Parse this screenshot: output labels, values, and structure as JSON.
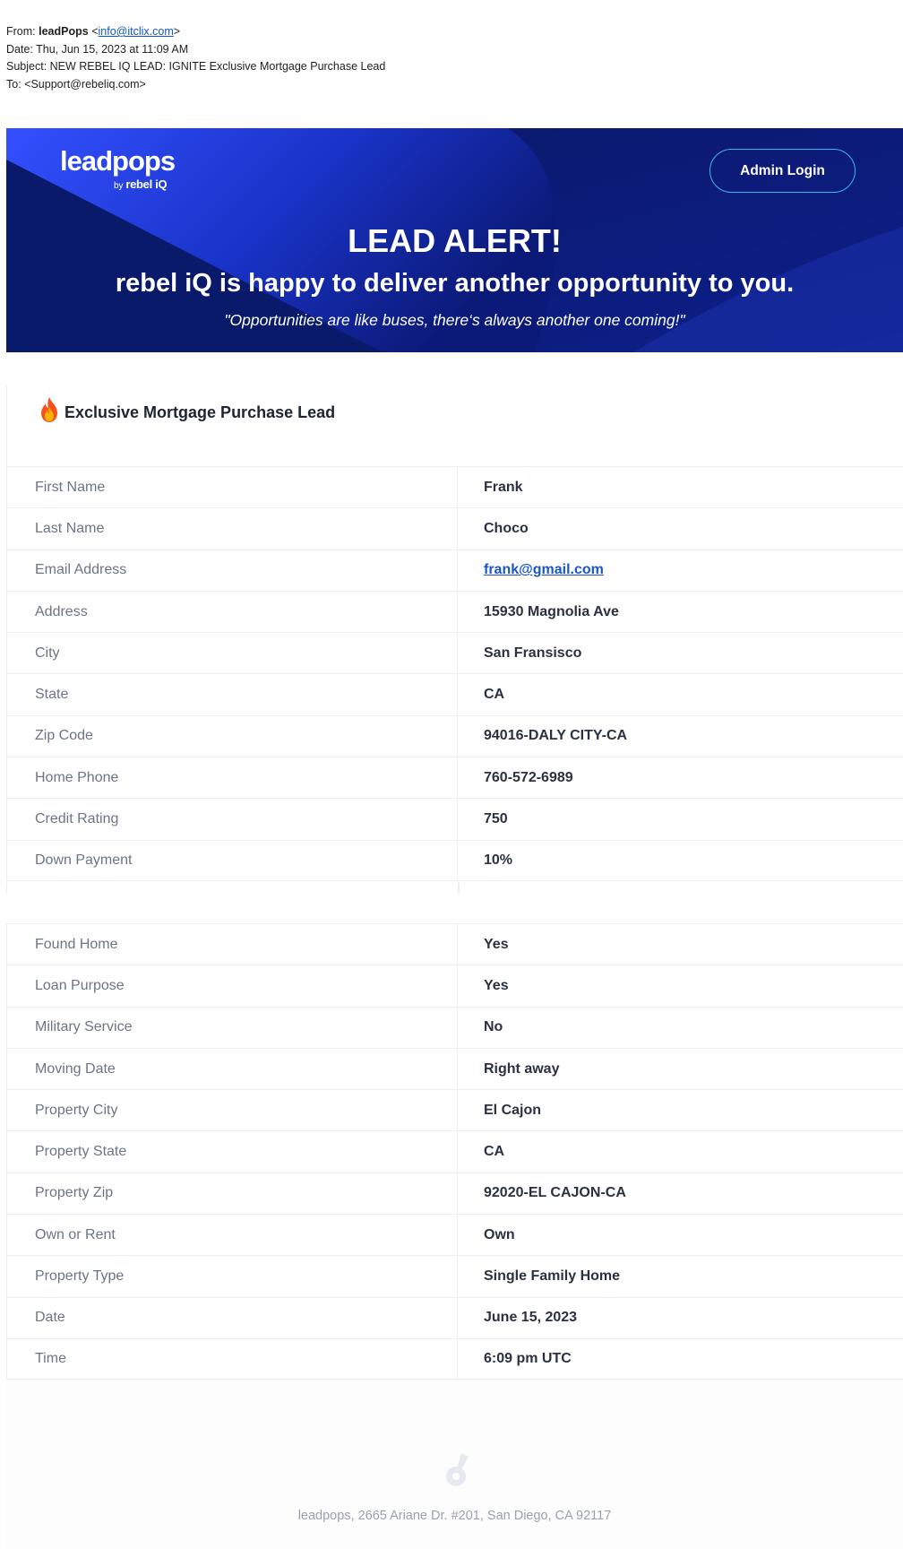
{
  "email": {
    "from_label": "From:",
    "from_name": "leadPops",
    "from_open": "<",
    "from_email": "info@itclix.com",
    "from_close": ">",
    "date_line": "Date: Thu, Jun 15, 2023 at 11:09 AM",
    "subject_line": "Subject: NEW REBEL IQ LEAD: IGNITE Exclusive Mortgage Purchase Lead",
    "to_line": "To: <Support@rebeliq.com>"
  },
  "banner": {
    "logo_word": "leadpops",
    "logo_by": "by",
    "logo_brand": "rebel iQ",
    "admin_login": "Admin Login",
    "title": "LEAD ALERT!",
    "subtitle": "rebel iQ is happy to deliver another opportunity to you.",
    "quote": "\"Opportunities are like buses, there‘s always another one coming!\"",
    "colors": {
      "dark": "#0a1a6b",
      "bright": "#2f4ff0",
      "button_border": "#3fb4e8"
    }
  },
  "lead": {
    "title": "Exclusive Mortgage Purchase Lead",
    "icon": "fire-icon"
  },
  "table1": [
    {
      "label": "First Name",
      "value": "Frank"
    },
    {
      "label": "Last Name",
      "value": "Choco"
    },
    {
      "label": "Email Address",
      "value": "frank@gmail.com"
    },
    {
      "label": "Address",
      "value": "15930 Magnolia Ave"
    },
    {
      "label": "City",
      "value": "San Fransisco"
    },
    {
      "label": "State",
      "value": "CA"
    },
    {
      "label": "Zip Code",
      "value": "94016-DALY CITY-CA"
    },
    {
      "label": "Home Phone",
      "value": "760-572-6989"
    },
    {
      "label": "Credit Rating",
      "value": "750"
    },
    {
      "label": "Down Payment",
      "value": "10%"
    }
  ],
  "table2": [
    {
      "label": "Found Home",
      "value": "Yes"
    },
    {
      "label": "Loan Purpose",
      "value": "Yes"
    },
    {
      "label": "Military Service",
      "value": "No"
    },
    {
      "label": "Moving Date",
      "value": "Right away"
    },
    {
      "label": "Property City",
      "value": "El Cajon"
    },
    {
      "label": "Property State",
      "value": "CA"
    },
    {
      "label": "Property Zip",
      "value": "92020-EL CAJON-CA"
    },
    {
      "label": "Own or Rent",
      "value": "Own"
    },
    {
      "label": "Property Type",
      "value": "Single Family Home"
    },
    {
      "label": "Date",
      "value": "June 15, 2023"
    },
    {
      "label": "Time",
      "value": "6:09 pm UTC"
    }
  ],
  "footer": {
    "address": "leadpops, 2665 Ariane Dr. #201, San Diego, CA 92117",
    "icon": "leadpops-pin-icon"
  }
}
